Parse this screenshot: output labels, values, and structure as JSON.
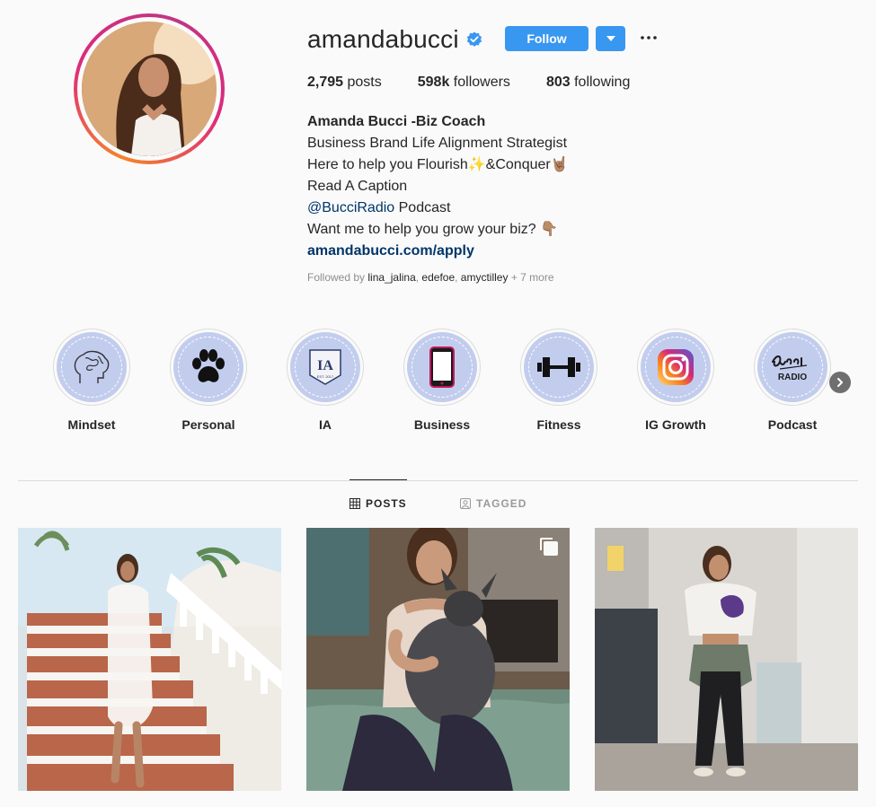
{
  "profile": {
    "username": "amandabucci",
    "follow_label": "Follow",
    "more_label": "•••",
    "stats": {
      "posts_count": "2,795",
      "posts_label": "posts",
      "followers_count": "598k",
      "followers_label": "followers",
      "following_count": "803",
      "following_label": "following"
    },
    "bio": {
      "name": "Amanda Bucci -Biz Coach",
      "line1": "Business Brand Life Alignment Strategist",
      "line2": "Here to help you Flourish✨&Conquer🤘🏽",
      "line3": "Read A Caption",
      "line4_mention": "@BucciRadio",
      "line4_rest": " Podcast",
      "line5": "Want me to help you grow your biz? 👇🏽",
      "link": "amandabucci.com/apply"
    },
    "followed_by": {
      "prefix": "Followed by ",
      "users": [
        "lina_jalina",
        "edefoe",
        "amyctilley"
      ],
      "sep": ", ",
      "suffix": " + 7 more"
    }
  },
  "highlights": [
    {
      "label": "Mindset",
      "icon": "brain-icon"
    },
    {
      "label": "Personal",
      "icon": "paw-icon"
    },
    {
      "label": "IA",
      "icon": "ia-badge-icon"
    },
    {
      "label": "Business",
      "icon": "phone-icon"
    },
    {
      "label": "Fitness",
      "icon": "dumbbell-icon"
    },
    {
      "label": "IG Growth",
      "icon": "instagram-icon"
    },
    {
      "label": "Podcast",
      "icon": "bucci-radio-icon"
    }
  ],
  "tabs": {
    "posts": "POSTS",
    "tagged": "TAGGED"
  },
  "colors": {
    "follow_blue": "#3897f0",
    "highlight_bg": "#c2cdee",
    "link_blue": "#003569"
  }
}
